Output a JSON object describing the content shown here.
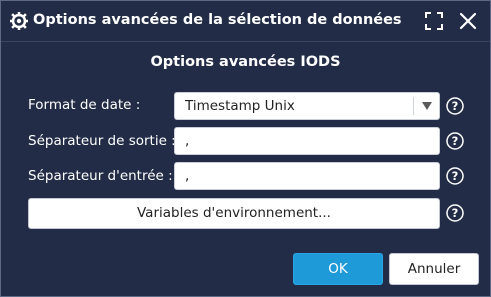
{
  "window": {
    "title": "Options avancées de la sélection de données",
    "icon": "gear-database-icon",
    "controls": [
      "maximize-icon",
      "close-icon"
    ]
  },
  "section": {
    "title": "Options avancées IODS"
  },
  "fields": {
    "date_format": {
      "label": "Format de date :",
      "value": "Timestamp Unix"
    },
    "output_separator": {
      "label": "Séparateur de sortie :",
      "value": ","
    },
    "input_separator": {
      "label": "Séparateur d'entrée :",
      "value": ","
    }
  },
  "buttons": {
    "env_vars": "Variables d'environnement...",
    "ok": "OK",
    "cancel": "Annuler"
  },
  "colors": {
    "background": "#222c46",
    "accent": "#1f9ad9",
    "text": "#ffffff"
  }
}
